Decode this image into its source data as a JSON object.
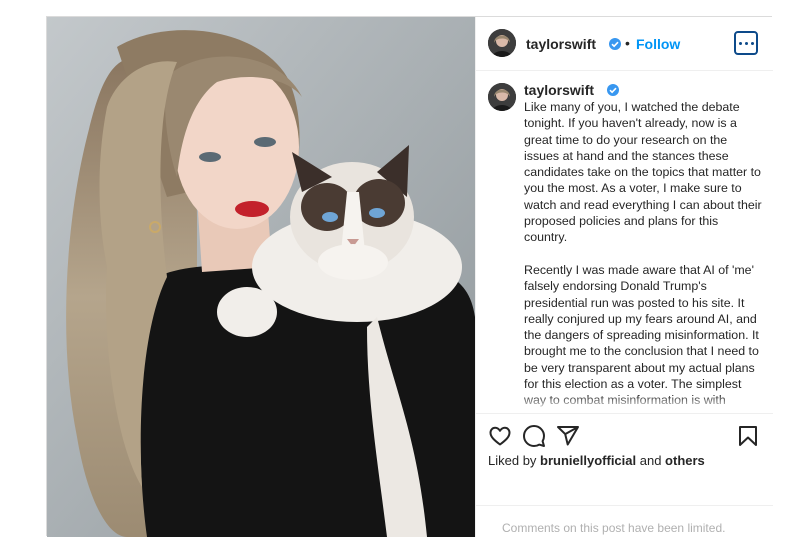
{
  "post": {
    "username": "taylorswift",
    "follow_label": "Follow",
    "separator": "•",
    "caption_username": "taylorswift",
    "caption_paragraphs": [
      "Like many of you, I watched the debate tonight. If you haven't already, now is a great time to do your research on the issues at hand and the stances these candidates take on the topics that matter to you the most. As a voter, I make sure to watch and read everything I can about their proposed policies and plans for this country.",
      "Recently I was made aware that AI of 'me' falsely endorsing Donald Trump's presidential run was posted to his site. It really conjured up my fears around AI, and the dangers of spreading misinformation. It brought me to the conclusion that I need to be very transparent about my actual plans for this election as a voter. The simplest way to combat misinformation is with"
    ],
    "liked_by_prefix": "Liked by ",
    "liked_by_user": "bruniellyofficial",
    "liked_by_and": " and ",
    "liked_by_others": "others",
    "comments_limited": "Comments on this post have been limited."
  },
  "icons": {
    "verified": "verified-badge-icon",
    "more": "more-options-icon",
    "like": "heart-icon",
    "comment": "comment-icon",
    "share": "send-icon",
    "save": "bookmark-icon"
  },
  "colors": {
    "follow": "#0095f6",
    "verified": "#3897f0",
    "text": "#262626",
    "muted": "#b0b0b0",
    "border": "#dbdbdb"
  }
}
